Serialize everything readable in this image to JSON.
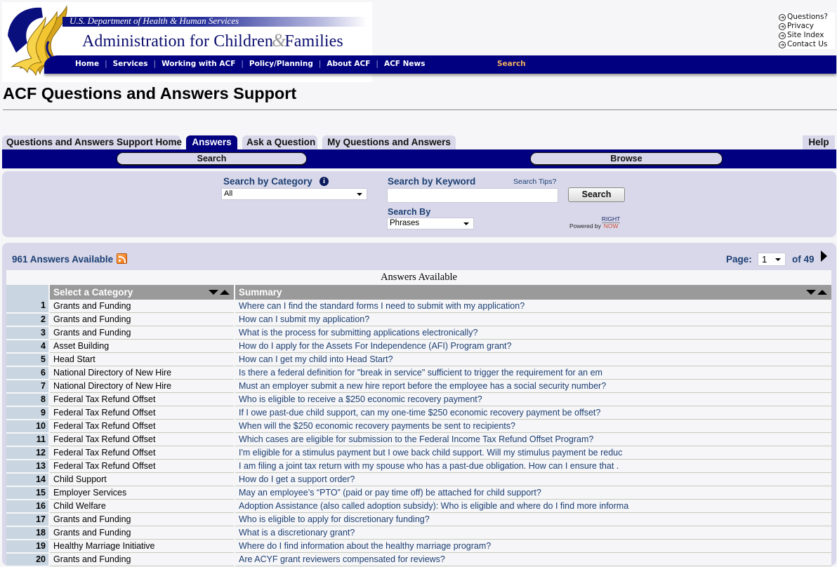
{
  "banner": {
    "department": "U.S. Department of Health & Human Services",
    "agency_part1": "Administration for Children",
    "agency_amp": "&",
    "agency_part2": "Families",
    "nav": [
      "Home",
      "Services",
      "Working with ACF",
      "Policy/Planning",
      "About ACF",
      "ACF News"
    ],
    "nav_search": "Search",
    "utility_links": [
      "Questions?",
      "Privacy",
      "Site Index",
      "Contact Us"
    ]
  },
  "page_title": "ACF Questions and Answers Support",
  "tabs": [
    {
      "label": "Questions and Answers Support Home",
      "active": false
    },
    {
      "label": "Answers",
      "active": true
    },
    {
      "label": "Ask a Question",
      "active": false
    },
    {
      "label": "My Questions and Answers",
      "active": false
    }
  ],
  "help_label": "Help",
  "subnav": {
    "search": "Search",
    "browse": "Browse"
  },
  "search_panel": {
    "category_label": "Search by Category",
    "category_value": "All",
    "keyword_label": "Search by Keyword",
    "keyword_value": "",
    "search_tips": "Search Tips?",
    "search_button": "Search",
    "search_by_label": "Search By",
    "search_by_value": "Phrases",
    "powered_by": "Powered by",
    "powered_right": "RIGHT",
    "powered_now": "NOW"
  },
  "results": {
    "count_label": "961 Answers Available",
    "page_label": "Page:",
    "page_value": "1",
    "page_of": "of 49",
    "caption": "Answers Available",
    "col_category": "Select a Category",
    "col_summary": "Summary",
    "rows": [
      {
        "n": "1",
        "category": "Grants and Funding",
        "summary": "Where can I find the standard forms I need to submit with my application?"
      },
      {
        "n": "2",
        "category": "Grants and Funding",
        "summary": "How can I submit my application?"
      },
      {
        "n": "3",
        "category": "Grants and Funding",
        "summary": "What is the process for submitting applications electronically?"
      },
      {
        "n": "4",
        "category": "Asset Building",
        "summary": "How do I apply for the Assets For Independence (AFI) Program grant?"
      },
      {
        "n": "5",
        "category": "Head Start",
        "summary": "How can I get my child into Head Start?"
      },
      {
        "n": "6",
        "category": "National Directory of New Hire",
        "summary": "Is there a federal definition for \"break in service\" sufficient to trigger the requirement for an em"
      },
      {
        "n": "7",
        "category": "National Directory of New Hire",
        "summary": "Must an employer submit a new hire report before the employee has a social security number?"
      },
      {
        "n": "8",
        "category": "Federal Tax Refund Offset",
        "summary": "Who is eligible to receive a $250 economic recovery payment?"
      },
      {
        "n": "9",
        "category": "Federal Tax Refund Offset",
        "summary": "If I owe past-due child support, can my one-time $250 economic recovery payment be offset?"
      },
      {
        "n": "10",
        "category": "Federal Tax Refund Offset",
        "summary": "When will the $250 economic recovery payments be sent to recipients?"
      },
      {
        "n": "11",
        "category": "Federal Tax Refund Offset",
        "summary": "Which cases are eligible for submission to the Federal Income Tax Refund Offset Program?"
      },
      {
        "n": "12",
        "category": "Federal Tax Refund Offset",
        "summary": "I'm eligible for a stimulus payment but I owe back child support. Will my stimulus payment be reduc"
      },
      {
        "n": "13",
        "category": "Federal Tax Refund Offset",
        "summary": "I am filing a joint tax return with my spouse who has a past-due obligation. How can I ensure that ."
      },
      {
        "n": "14",
        "category": "Child Support",
        "summary": "How do I get a support order?"
      },
      {
        "n": "15",
        "category": "Employer Services",
        "summary": "May an employee’s “PTO” (paid or pay time off) be attached for child support?"
      },
      {
        "n": "16",
        "category": "Child Welfare",
        "summary": "Adoption Assistance (also called adoption subsidy): Who is eligible and where do I find more informa"
      },
      {
        "n": "17",
        "category": "Grants and Funding",
        "summary": "Who is eligible to apply for discretionary funding?"
      },
      {
        "n": "18",
        "category": "Grants and Funding",
        "summary": "What is a discretionary grant?"
      },
      {
        "n": "19",
        "category": "Healthy Marriage Initiative",
        "summary": "Where do I find information about the healthy marriage program?"
      },
      {
        "n": "20",
        "category": "Grants and Funding",
        "summary": "Are ACYF grant reviewers compensated for reviews?"
      }
    ]
  },
  "colors": {
    "nav_blue": "#000080",
    "panel_lavender": "#d8d8ea",
    "link_blue": "#1c3f73",
    "nav_search_orange": "#f0b060",
    "header_gray": "#9a9a9a"
  }
}
